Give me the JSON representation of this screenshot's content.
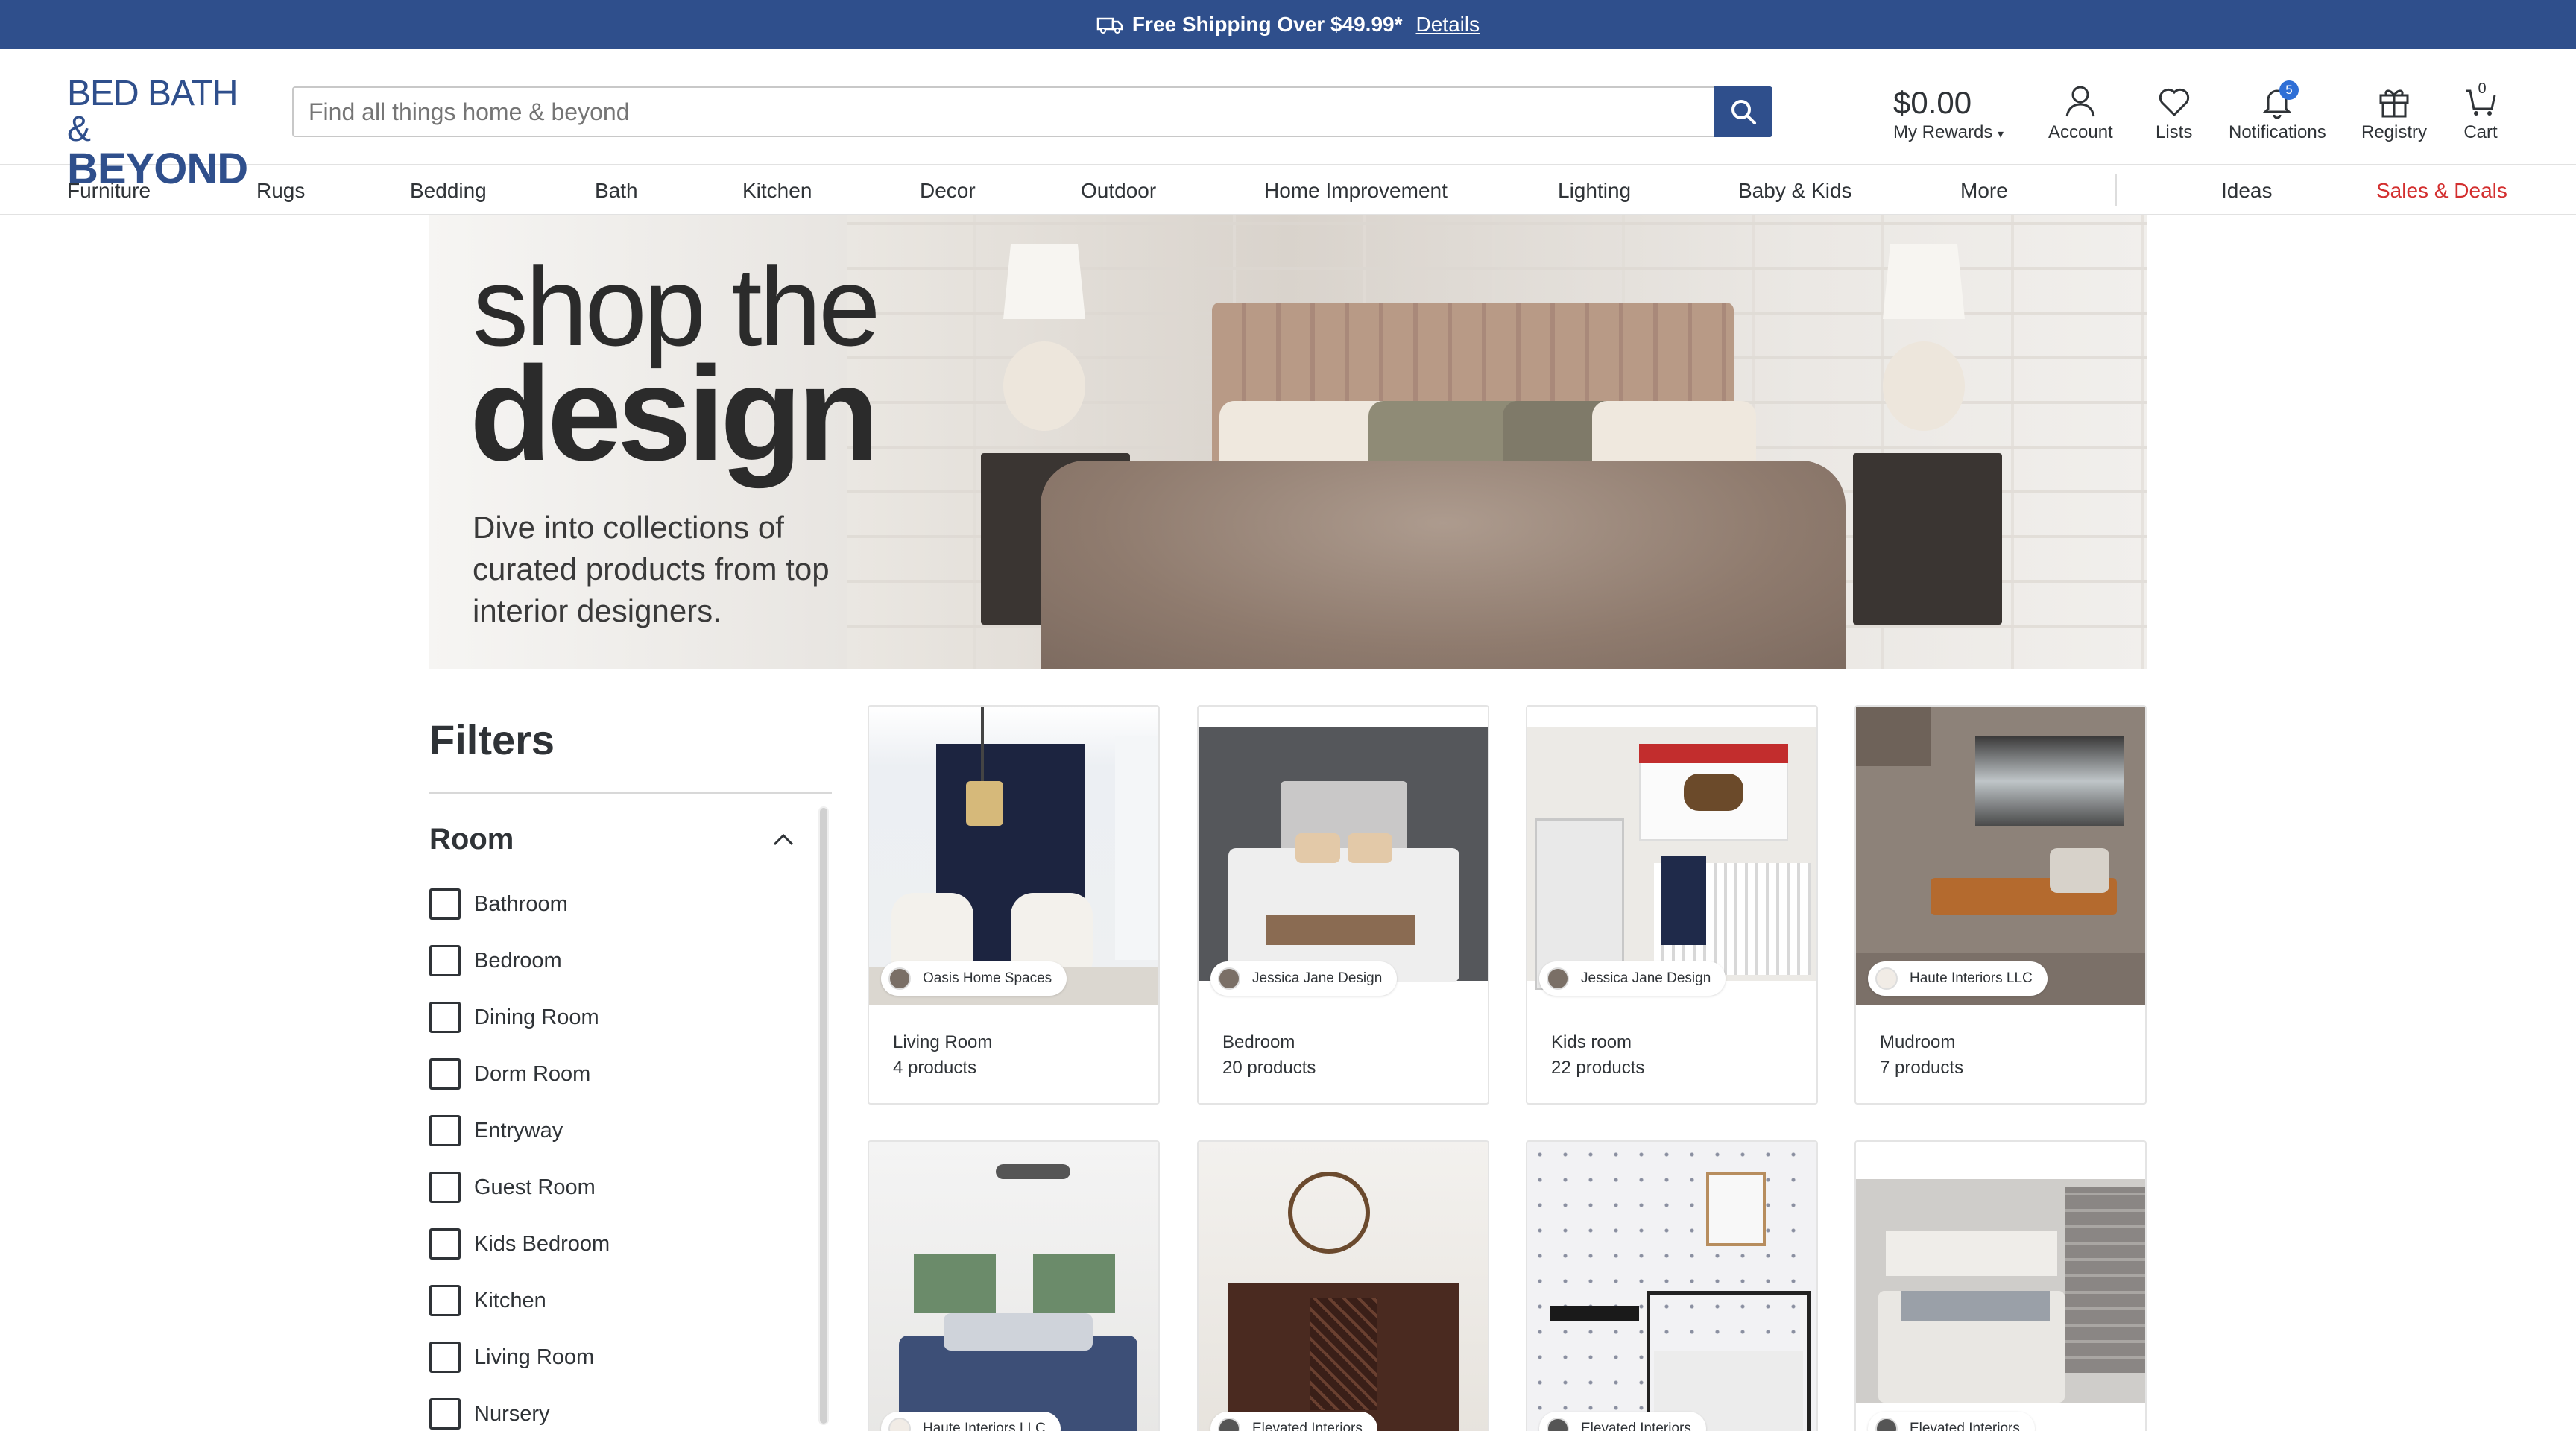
{
  "promo": {
    "text": "Free Shipping Over $49.99*",
    "link": "Details"
  },
  "brand": {
    "line1": "BED BATH &",
    "line2": "BEYOND",
    "color": "#2f4f8c"
  },
  "search": {
    "placeholder": "Find all things home & beyond",
    "value": ""
  },
  "rewards": {
    "amount": "$0.00",
    "label": "My Rewards"
  },
  "header_icons": [
    {
      "label": "Account",
      "icon": "account-icon"
    },
    {
      "label": "Lists",
      "icon": "heart-icon"
    },
    {
      "label": "Notifications",
      "icon": "bell-icon",
      "badge": "5"
    },
    {
      "label": "Registry",
      "icon": "gift-icon"
    },
    {
      "label": "Cart",
      "icon": "cart-icon",
      "badge": "0"
    }
  ],
  "nav": [
    "Furniture",
    "Rugs",
    "Bedding",
    "Bath",
    "Kitchen",
    "Decor",
    "Outdoor",
    "Home Improvement",
    "Lighting",
    "Baby & Kids",
    "More"
  ],
  "nav_right": [
    "Ideas",
    "Sales & Deals"
  ],
  "hero": {
    "title_line1": "shop the",
    "title_line2": "design",
    "description": "Dive into collections of curated products from top interior designers."
  },
  "filters": {
    "title": "Filters",
    "room_title": "Room",
    "rooms": [
      "Bathroom",
      "Bedroom",
      "Dining Room",
      "Dorm Room",
      "Entryway",
      "Guest Room",
      "Kids Bedroom",
      "Kitchen",
      "Living Room",
      "Nursery"
    ]
  },
  "cards": [
    {
      "designer": "Oasis Home Spaces",
      "room": "Living Room",
      "count": "4 products"
    },
    {
      "designer": "Jessica Jane Design",
      "room": "Bedroom",
      "count": "20 products"
    },
    {
      "designer": "Jessica Jane Design",
      "room": "Kids room",
      "count": "22 products"
    },
    {
      "designer": "Haute Interiors LLC",
      "room": "Mudroom",
      "count": "7 products"
    },
    {
      "designer": "Haute Interiors LLC"
    },
    {
      "designer": "Elevated Interiors"
    },
    {
      "designer": "Elevated Interiors"
    },
    {
      "designer": "Elevated Interiors"
    }
  ],
  "colors": {
    "navy": "#2f4f8c",
    "deals": "#d32f2f",
    "badge": "#2f6fd6"
  }
}
